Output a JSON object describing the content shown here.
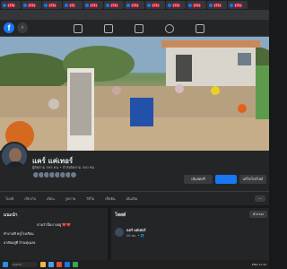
{
  "browser": {
    "tabs": [
      {
        "badge": "(73)"
      },
      {
        "badge": "(71)"
      },
      {
        "badge": "(71)"
      },
      {
        "badge": "(7)"
      },
      {
        "badge": "(71)"
      },
      {
        "badge": "(71)"
      },
      {
        "badge": "(71)"
      },
      {
        "badge": "(71)"
      },
      {
        "badge": "(71)"
      },
      {
        "badge": "(71)"
      },
      {
        "badge": "(71)"
      },
      {
        "badge": "(71)"
      }
    ]
  },
  "profile": {
    "name": "แคร์ แค่เทอร์",
    "subinfo": "ผู้ติดตาม 595 คน • กำลังติดตาม 300 คน",
    "buttons": {
      "story": "เพิ่มสตอรี่",
      "edit": "แก้ไขโปรไฟล์"
    },
    "nav": [
      "โพสต์",
      "เกี่ยวกับ",
      "เพื่อน",
      "รูปภาพ",
      "วิดีโอ",
      "เช็คอิน",
      "เพิ่มเติม"
    ]
  },
  "intro": {
    "heading": "แนะนำ",
    "bio": "ตามรัวปั้มบางอยู่ ❤️❤️",
    "rows": [
      "ทำงานที่ ครูโรงเรียน",
      "อาศัยอยู่ที่ บ้านทุ่งแสง"
    ]
  },
  "posts": {
    "heading": "โพสต์",
    "filter": "ตัวกรอง",
    "post_name": "แคร์ แค่เทอร์",
    "post_time": "20 ชม. • 🌐"
  },
  "taskbar": {
    "search": "Search",
    "tray": "ENG 21:32"
  },
  "colors": {
    "fb_blue": "#1877f2",
    "bg": "#18191a",
    "card": "#242526"
  }
}
